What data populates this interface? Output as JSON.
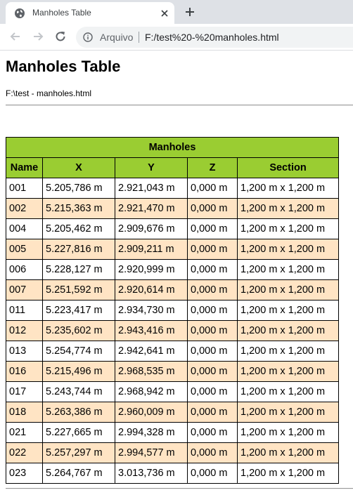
{
  "browser": {
    "tab_title": "Manholes Table",
    "protocol_label": "Arquivo",
    "url": "F:/test%20-%20manholes.html"
  },
  "page": {
    "title": "Manholes Table",
    "file_path": "F:\\test - manholes.html"
  },
  "table": {
    "caption": "Manholes",
    "columns": [
      "Name",
      "X",
      "Y",
      "Z",
      "Section"
    ],
    "rows": [
      [
        "001",
        "5.205,786 m",
        "2.921,043 m",
        "0,000 m",
        "1,200 m x 1,200 m"
      ],
      [
        "002",
        "5.215,363 m",
        "2.921,470 m",
        "0,000 m",
        "1,200 m x 1,200 m"
      ],
      [
        "004",
        "5.205,462 m",
        "2.909,676 m",
        "0,000 m",
        "1,200 m x 1,200 m"
      ],
      [
        "005",
        "5.227,816 m",
        "2.909,211 m",
        "0,000 m",
        "1,200 m x 1,200 m"
      ],
      [
        "006",
        "5.228,127 m",
        "2.920,999 m",
        "0,000 m",
        "1,200 m x 1,200 m"
      ],
      [
        "007",
        "5.251,592 m",
        "2.920,614 m",
        "0,000 m",
        "1,200 m x 1,200 m"
      ],
      [
        "011",
        "5.223,417 m",
        "2.934,730 m",
        "0,000 m",
        "1,200 m x 1,200 m"
      ],
      [
        "012",
        "5.235,602 m",
        "2.943,416 m",
        "0,000 m",
        "1,200 m x 1,200 m"
      ],
      [
        "013",
        "5.254,774 m",
        "2.942,641 m",
        "0,000 m",
        "1,200 m x 1,200 m"
      ],
      [
        "016",
        "5.215,496 m",
        "2.968,535 m",
        "0,000 m",
        "1,200 m x 1,200 m"
      ],
      [
        "017",
        "5.243,744 m",
        "2.968,942 m",
        "0,000 m",
        "1,200 m x 1,200 m"
      ],
      [
        "018",
        "5.263,386 m",
        "2.960,009 m",
        "0,000 m",
        "1,200 m x 1,200 m"
      ],
      [
        "021",
        "5.227,665 m",
        "2.994,328 m",
        "0,000 m",
        "1,200 m x 1,200 m"
      ],
      [
        "022",
        "5.257,297 m",
        "2.994,577 m",
        "0,000 m",
        "1,200 m x 1,200 m"
      ],
      [
        "023",
        "5.264,767 m",
        "3.013,736 m",
        "0,000 m",
        "1,200 m x 1,200 m"
      ]
    ]
  },
  "colors": {
    "header_bg": "#9acd32",
    "row_alt_bg": "#ffe4c4",
    "row_bg": "#ffffff",
    "tabstrip_bg": "#dee1e6"
  },
  "icons": {
    "favicon": "globe-icon",
    "close": "close-icon",
    "new_tab": "plus-icon",
    "back": "arrow-left-icon",
    "forward": "arrow-right-icon",
    "reload": "reload-icon",
    "info": "info-icon"
  }
}
